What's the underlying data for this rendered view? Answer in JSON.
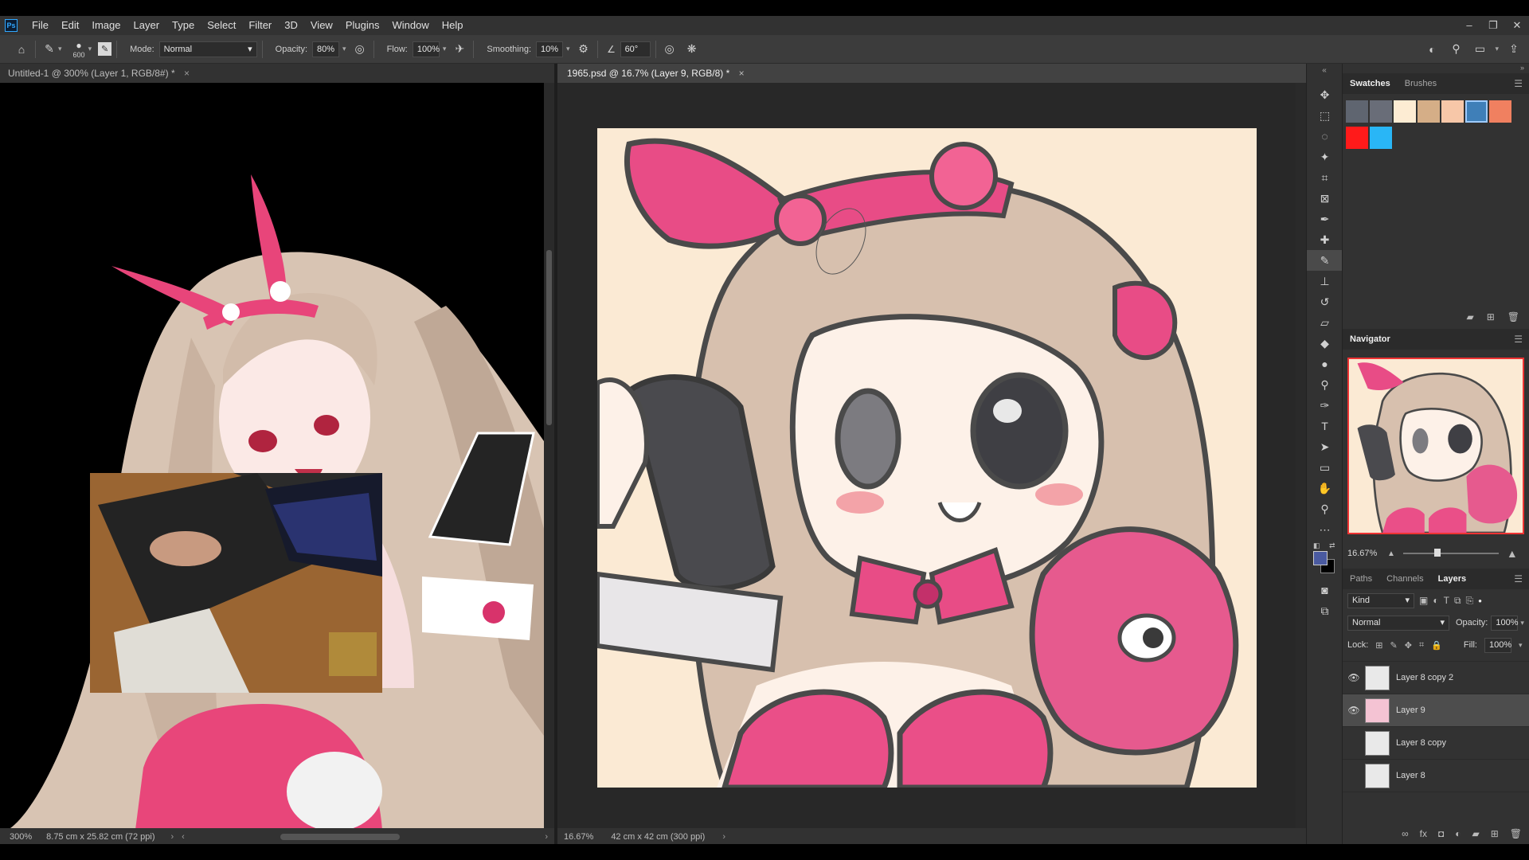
{
  "menubar": {
    "logo": "Ps",
    "items": [
      "File",
      "Edit",
      "Image",
      "Layer",
      "Type",
      "Select",
      "Filter",
      "3D",
      "View",
      "Plugins",
      "Window",
      "Help"
    ],
    "window_controls": [
      "–",
      "❐",
      "✕"
    ]
  },
  "options": {
    "brush_size": "600",
    "mode_label": "Mode:",
    "mode_value": "Normal",
    "opacity_label": "Opacity:",
    "opacity_value": "80%",
    "flow_label": "Flow:",
    "flow_value": "100%",
    "smoothing_label": "Smoothing:",
    "smoothing_value": "10%",
    "angle_value": "60°"
  },
  "doc1": {
    "tab_title": "Untitled-1 @ 300% (Layer 1, RGB/8#) *",
    "zoom": "300%",
    "size_info": "8.75 cm x 25.82 cm (72 ppi)"
  },
  "doc2": {
    "tab_title": "1965.psd @ 16.7% (Layer 9, RGB/8) *",
    "zoom": "16.67%",
    "size_info": "42 cm x 42 cm (300 ppi)"
  },
  "swatches": {
    "tabs": [
      "Swatches",
      "Brushes"
    ],
    "colors": [
      "#5f6570",
      "#696d78",
      "#fdecd3",
      "#d5ae87",
      "#f7c7a8",
      "#3f7fb8",
      "#f08060",
      "#ff1a1a",
      "#29b6f6"
    ]
  },
  "navigator": {
    "title": "Navigator",
    "zoom": "16.67%"
  },
  "layers_panel": {
    "tabs": [
      "Paths",
      "Channels",
      "Layers"
    ],
    "kind_label": "Kind",
    "blend_mode": "Normal",
    "opacity_label": "Opacity:",
    "opacity_value": "100%",
    "lock_label": "Lock:",
    "fill_label": "Fill:",
    "fill_value": "100%",
    "layers": [
      {
        "name": "Layer 8 copy 2",
        "visible": true
      },
      {
        "name": "Layer 9",
        "visible": true
      },
      {
        "name": "Layer 8 copy",
        "visible": false
      },
      {
        "name": "Layer 8",
        "visible": false
      }
    ]
  },
  "colors": {
    "foreground": "#4a5aa0",
    "background": "#000000",
    "accent_pink": "#e8457a",
    "canvas_cream": "#fbead4"
  }
}
